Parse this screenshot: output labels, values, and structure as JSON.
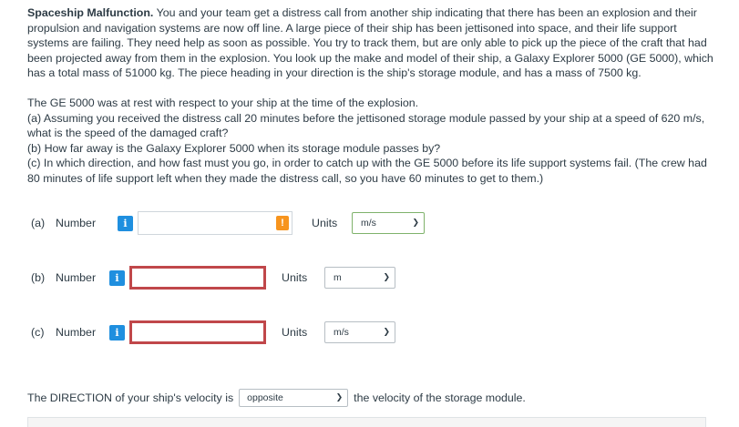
{
  "problem": {
    "title": "Spaceship Malfunction.",
    "intro": " You and your team get a distress call from another ship indicating that there has been an explosion and their propulsion and navigation systems are now off line. A large piece of their ship has been jettisoned into space, and their life support systems are failing. They need help as soon as possible. You try to track them, but are only able to pick up the piece of the craft that had been projected away from them in the explosion. You look up the make and model of their ship, a Galaxy Explorer 5000 (GE 5000), which has a total mass of 51000 kg. The piece heading in your direction is the ship's storage module, and has a mass of 7500 kg.",
    "line1": "The GE 5000 was at rest with respect to your ship at the time of the explosion.",
    "part_a": "(a) Assuming you received the distress call 20 minutes before the jettisoned storage module passed by your ship at a speed of 620 m/s, what is the speed of the damaged craft?",
    "part_b": "(b) How far away is the Galaxy Explorer 5000 when its storage module passes by?",
    "part_c": "(c) In which direction, and how fast must you go, in order to catch up with the GE 5000 before its life support systems fail. (The crew had 80 minutes of life support left when they made the distress call, so you have 60 minutes to get to them.)"
  },
  "answers": [
    {
      "part": "(a)",
      "label": "Number",
      "info": "i",
      "value": "",
      "warning": "!",
      "units_label": "Units",
      "unit": "m/s"
    },
    {
      "part": "(b)",
      "label": "Number",
      "info": "i",
      "value": "",
      "units_label": "Units",
      "unit": "m"
    },
    {
      "part": "(c)",
      "label": "Number",
      "info": "i",
      "value": "",
      "units_label": "Units",
      "unit": "m/s"
    }
  ],
  "direction": {
    "prefix": "The DIRECTION of your ship's velocity is",
    "selected": "opposite",
    "suffix": "the velocity of the storage module."
  },
  "colors": {
    "info": "#1f8fdf",
    "warning": "#f7941d",
    "error_border": "#c0474a",
    "valid_border": "#7fb26b"
  }
}
